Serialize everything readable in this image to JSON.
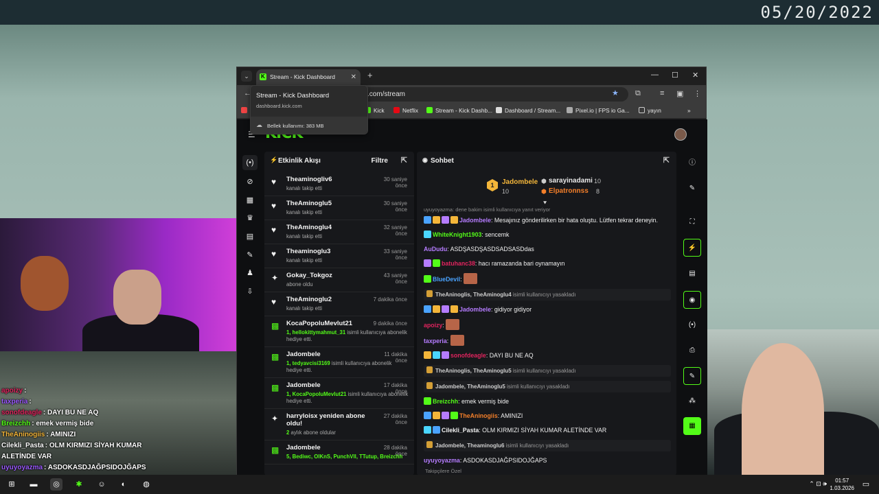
{
  "desktop": {
    "date_stamp": "05/20/2022"
  },
  "overlay_chat": [
    {
      "user": "apoizy",
      "text": ": ",
      "color": "#e0245e"
    },
    {
      "user": "taxperia",
      "text": ": ",
      "color": "#9b59ff"
    },
    {
      "user": "sonofdeagle",
      "text": ": DAYI BU NE AQ",
      "color": "#e0245e"
    },
    {
      "user": "Breizchh",
      "text": ": emek vermiş bide",
      "color": "#53fc18"
    },
    {
      "user": "TheAninogiis",
      "text": ": AMINIZI",
      "color": "#f4b63a"
    },
    {
      "user": "Cilekli_Pasta",
      "text": ": OLM KIRMIZI SİYAH KUMAR ALETİNDE VAR",
      "color": "#ffffff"
    },
    {
      "user": "uyuyoyazma",
      "text": ": ASDOKASDJAĞPSIDOJĞAPS",
      "color": "#9b59ff"
    }
  ],
  "browser": {
    "tab_title": "Stream - Kick Dashboard",
    "url_rest": ".com/stream",
    "bookmarks": [
      "Kick",
      "Netflix",
      "Stream - Kick Dashb...",
      "Dashboard / Stream...",
      "Pixel.io | FPS io Ga...",
      "yayın"
    ],
    "tab_popup": {
      "title": "Stream - Kick Dashboard",
      "domain": "dashboard.kick.com",
      "memory": "Bellek kullanımı: 383 MB"
    }
  },
  "dashboard": {
    "logo": "KICK",
    "activity": {
      "title": "Etkinlik Akışı",
      "filter": "Filtre",
      "items": [
        {
          "icon": "heart",
          "name": "Theaminogliv6",
          "time": "30 saniye önce",
          "sub": "kanalı takip etti"
        },
        {
          "icon": "heart",
          "name": "TheAminoglu5",
          "time": "30 saniye önce",
          "sub": "kanalı takip etti"
        },
        {
          "icon": "heart",
          "name": "TheAminoglu4",
          "time": "32 saniye önce",
          "sub": "kanalı takip etti"
        },
        {
          "icon": "heart",
          "name": "Theaminoglu3",
          "time": "33 saniye önce",
          "sub": "kanalı takip etti"
        },
        {
          "icon": "star",
          "name": "Gokay_Tokgoz",
          "time": "43 saniye önce",
          "sub": "abone oldu"
        },
        {
          "icon": "heart",
          "name": "TheAminoglu2",
          "time": "7 dakika önce",
          "sub": "kanalı takip etti"
        },
        {
          "icon": "gift",
          "name": "KocaPopoluMevlut21",
          "time": "9 dakika önce",
          "sub_hl": "1, hellokittymahmut_31",
          "sub": " isimli kullanıcıya abonelik hediye etti."
        },
        {
          "icon": "gift",
          "name": "Jadombele",
          "time": "11 dakika önce",
          "sub_hl": "1, tedyavcisi3169",
          "sub": " isimli kullanıcıya abonelik hediye etti."
        },
        {
          "icon": "gift",
          "name": "Jadombele",
          "time": "17 dakika önce",
          "sub_hl": "1, KocaPopoluMevlut21",
          "sub": " isimli kullanıcıya abonelik hediye etti."
        },
        {
          "icon": "star",
          "name": "harryloisx yeniden abone oldu!",
          "time": "27 dakika önce",
          "sub_hl": "2",
          "sub": " aylık abone oldular"
        },
        {
          "icon": "gift",
          "name": "Jadombele",
          "time": "28 dakika önce",
          "sub_hl": "5, Bediwc, OlKnS, PunchVll, TTutup, Breizchh",
          "sub": ""
        }
      ]
    },
    "chat": {
      "title": "Sohbet",
      "leaderboard": {
        "first": {
          "rank": "1",
          "name": "Jadombele",
          "count": "10"
        },
        "second": {
          "name": "sarayinadami",
          "count": "10"
        },
        "third": {
          "name": "Elpatronnss",
          "count": "8"
        }
      },
      "reply_note": "uyuyoyazma: dene bakim isimli kullanıcıya yanıt veriyor",
      "messages": [
        {
          "type": "msg",
          "user": "Jadombele",
          "color": "#b57cff",
          "badges": [
            "#4aa3ff",
            "#f4b63a",
            "#b57cff",
            "#f4b63a"
          ],
          "text": ": Mesajınız gönderilirken bir hata oluştu. Lütfen tekrar deneyin."
        },
        {
          "type": "msg",
          "user": "WhiteKnight1903",
          "color": "#53fc18",
          "badges": [
            "#4ad6ff"
          ],
          "text": ": sencemk"
        },
        {
          "type": "msg",
          "user": "AuDudu",
          "color": "#b57cff",
          "badges": [],
          "text": ": ASDŞASDŞASDSADSASDdas"
        },
        {
          "type": "msg",
          "user": "batuhanc38",
          "color": "#e0245e",
          "badges": [
            "#b57cff",
            "#53fc18"
          ],
          "text": ": hacı ramazanda bari oynamayın"
        },
        {
          "type": "msg",
          "user": "BlueDevil",
          "color": "#4aa3ff",
          "badges": [
            "#53fc18"
          ],
          "text": ": ",
          "emote": true
        },
        {
          "type": "sys",
          "users": "TheAninoglis, TheAminoglu4",
          "text": " isimli kullanıcıyı yasakladı"
        },
        {
          "type": "msg",
          "user": "Jadombele",
          "color": "#b57cff",
          "badges": [
            "#4aa3ff",
            "#f4b63a",
            "#b57cff",
            "#f4b63a"
          ],
          "text": ": gidiyor gidiyor"
        },
        {
          "type": "msg",
          "user": "apoizy",
          "color": "#e0245e",
          "badges": [],
          "text": ": ",
          "emote": true
        },
        {
          "type": "msg",
          "user": "taxperia",
          "color": "#b57cff",
          "badges": [],
          "text": ": ",
          "emote": true
        },
        {
          "type": "msg",
          "user": "sonofdeagle",
          "color": "#e0245e",
          "badges": [
            "#f4b63a",
            "#4ad6ff",
            "#b57cff"
          ],
          "text": ": DAYI BU NE AQ"
        },
        {
          "type": "sys",
          "users": "TheAninoglis, TheAminoglu5",
          "text": " isimli kullanıcıyı yasakladı"
        },
        {
          "type": "sys",
          "users": "Jadombele, TheAminoglu5",
          "text": " isimli kullanıcıyı yasakladı"
        },
        {
          "type": "msg",
          "user": "Breizchh",
          "color": "#53fc18",
          "badges": [
            "#53fc18"
          ],
          "text": ": emek vermiş bide"
        },
        {
          "type": "msg",
          "user": "TheAninogiis",
          "color": "#f47f2a",
          "badges": [
            "#4aa3ff",
            "#f4b63a",
            "#b57cff",
            "#53fc18"
          ],
          "text": ": AMINIZI"
        },
        {
          "type": "msg",
          "user": "Cilekli_Pasta",
          "color": "#f0f0f0",
          "badges": [
            "#4ad6ff",
            "#4aa3ff"
          ],
          "text": ": OLM KIRMIZI SİYAH KUMAR ALETİNDE VAR"
        },
        {
          "type": "sys",
          "users": "Jadombele, Theaminoglu6",
          "text": " isimli kullanıcıyı yasakladı"
        },
        {
          "type": "msg",
          "user": "uyuyoyazma",
          "color": "#b57cff",
          "badges": [],
          "text": ": ASDOKASDJAĞPSIDOJĞAPS"
        }
      ],
      "footer": "Takipçilere Özel"
    }
  },
  "taskbar": {
    "time": "01:57",
    "date": "1.03.2026"
  },
  "colors": {
    "kick_green": "#53fc18"
  }
}
